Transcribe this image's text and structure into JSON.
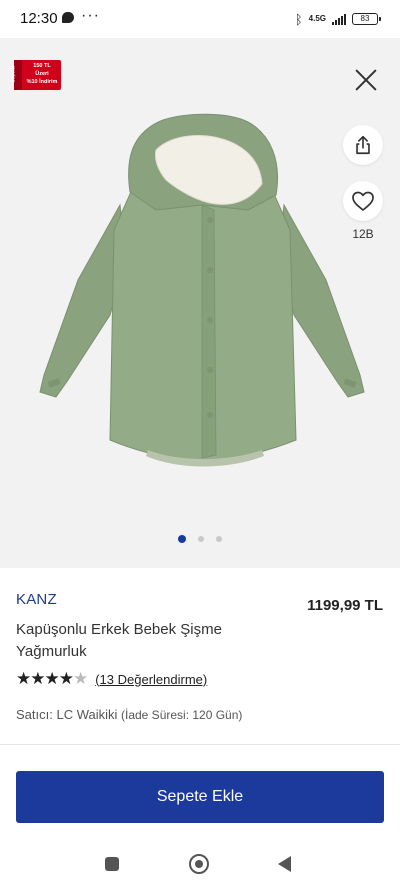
{
  "status_bar": {
    "time": "12:30",
    "dots": "···",
    "network": "4.5G",
    "battery": "83"
  },
  "gallery": {
    "promo": {
      "side_text": "Sepette",
      "line1": "150 TL",
      "line2": "Üzeri",
      "line3": "%10 İndirim"
    },
    "favorite_count": "12B",
    "slide_count": 3,
    "active_slide": 1
  },
  "product": {
    "brand": "KANZ",
    "price": "1199,99 TL",
    "title": "Kapüşonlu Erkek Bebek Şişme Yağmurluk",
    "rating": 4.5,
    "stars_filled": "★★★★",
    "stars_half": "★",
    "reviews": "(13 Değerlendirme)",
    "seller_label": "Satıcı: LC Waikiki",
    "return_period": "(İade Süresi: 120 Gün)"
  },
  "actions": {
    "add_to_cart": "Sepete Ekle"
  },
  "colors": {
    "brand_blue": "#1c3a9c",
    "coat_green": "#8aa27e",
    "promo_red": "#d0021b"
  }
}
